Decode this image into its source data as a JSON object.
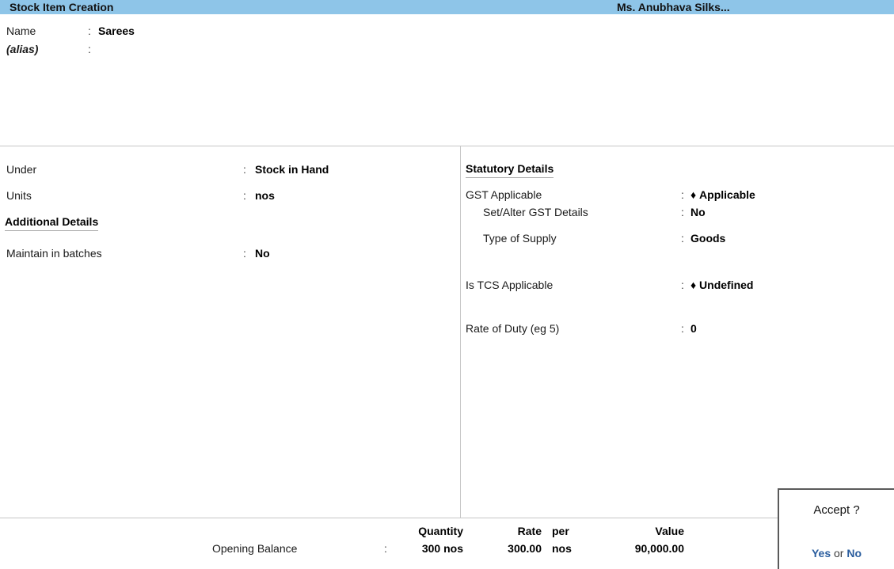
{
  "titlebar": {
    "screen_title": "Stock Item Creation",
    "company_name": "Ms. Anubhava Silks..."
  },
  "header_fields": {
    "name_label": "Name",
    "name_colon": ":",
    "name_value": "Sarees",
    "alias_label": "(alias)",
    "alias_colon": ":",
    "alias_value": ""
  },
  "left_panel": {
    "under_label": "Under",
    "under_colon": ":",
    "under_value": "Stock in Hand",
    "units_label": "Units",
    "units_colon": ":",
    "units_value": "nos",
    "additional_details_heading": "Additional Details",
    "maintain_batches_label": "Maintain in batches",
    "maintain_batches_colon": ":",
    "maintain_batches_value": "No"
  },
  "right_panel": {
    "statutory_details_heading": "Statutory Details",
    "gst_applicable_label": "GST Applicable",
    "gst_applicable_colon": ":",
    "gst_applicable_bullet": "♦",
    "gst_applicable_value": "Applicable",
    "set_alter_gst_label": "Set/Alter GST Details",
    "set_alter_gst_colon": ":",
    "set_alter_gst_value": "No",
    "type_of_supply_label": "Type of Supply",
    "type_of_supply_colon": ":",
    "type_of_supply_value": "Goods",
    "tcs_applicable_label": "Is TCS Applicable",
    "tcs_applicable_colon": ":",
    "tcs_applicable_bullet": "♦",
    "tcs_applicable_value": "Undefined",
    "rate_of_duty_label": "Rate of Duty (eg 5)",
    "rate_of_duty_colon": ":",
    "rate_of_duty_value": "0"
  },
  "footer": {
    "columns": {
      "quantity": "Quantity",
      "rate": "Rate",
      "per": "per",
      "value": "Value"
    },
    "row": {
      "label": "Opening Balance",
      "colon": ":",
      "quantity": "300 nos",
      "rate": "300.00",
      "per": "nos",
      "value": "90,000.00"
    }
  },
  "accept_dialog": {
    "title": "Accept ?",
    "yes_label": "Yes",
    "or_label": "or",
    "no_label": "No"
  },
  "colors": {
    "titlebar_bg": "#8ec5e8",
    "accent_link": "#2a5d9e",
    "rule": "#c6c6c6",
    "dialog_border": "#5a5a5a"
  }
}
